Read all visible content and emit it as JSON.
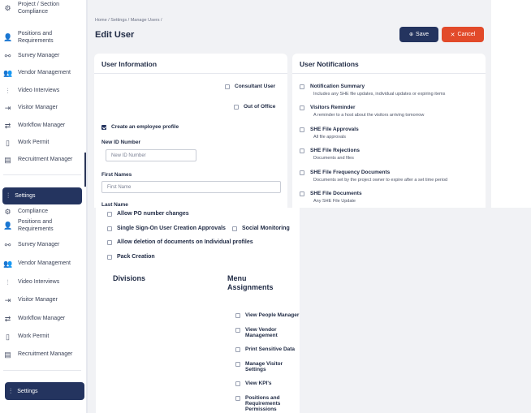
{
  "sidebar_top": {
    "items": [
      {
        "label": "Project / Section Compliance",
        "icon": "gear-icon"
      },
      {
        "label": "Positions and Requirements",
        "icon": "user-plus-icon"
      },
      {
        "label": "Survey Manager",
        "icon": "nodes-icon"
      },
      {
        "label": "Vendor Management",
        "icon": "users-icon"
      },
      {
        "label": "Video Interviews",
        "icon": "sliders-icon"
      },
      {
        "label": "Visitor Manager",
        "icon": "enter-icon"
      },
      {
        "label": "Workflow Manager",
        "icon": "arrows-icon"
      },
      {
        "label": "Work Permit",
        "icon": "document-icon"
      },
      {
        "label": "Recruitment Manager",
        "icon": "id-card-icon"
      }
    ],
    "settings_label": "Settings"
  },
  "sidebar_bottom": {
    "items": [
      {
        "label": "Compliance",
        "icon": "gear-icon"
      },
      {
        "label": "Positions and Requirements",
        "icon": "user-plus-icon"
      },
      {
        "label": "Survey Manager",
        "icon": "nodes-icon"
      },
      {
        "label": "Vendor Management",
        "icon": "users-icon"
      },
      {
        "label": "Video Interviews",
        "icon": "sliders-icon"
      },
      {
        "label": "Visitor Manager",
        "icon": "enter-icon"
      },
      {
        "label": "Workflow Manager",
        "icon": "arrows-icon"
      },
      {
        "label": "Work Permit",
        "icon": "document-icon"
      },
      {
        "label": "Recruitment Manager",
        "icon": "id-card-icon"
      }
    ],
    "settings_label": "Settings"
  },
  "header": {
    "breadcrumb": "Home  /  Settings  /  Manage Users  /",
    "title": "Edit User",
    "save_label": "Save",
    "cancel_label": "Cancel"
  },
  "user_info": {
    "title": "User Information",
    "consultant_user": "Consultant User",
    "out_of_office": "Out of Office",
    "create_employee_profile": "Create an employee profile",
    "new_id_label": "New ID Number",
    "new_id_placeholder": "New ID Number",
    "first_names_label": "First Names",
    "first_name_placeholder": "First Name",
    "last_name_label": "Last Name"
  },
  "notifications": {
    "title": "User Notifications",
    "items": [
      {
        "title": "Notification Summary",
        "desc": "Includes any SHE file updates, individual updates or expiring items"
      },
      {
        "title": "Visitors Reminder",
        "desc": "A reminder to a host about the visitors arriving tomorrow"
      },
      {
        "title": "SHE File Approvals",
        "desc": "All file approvals"
      },
      {
        "title": "SHE File Rejections",
        "desc": "Documents and files"
      },
      {
        "title": "SHE File Frequency Documents",
        "desc": "Documents set by the project owner to expire after a set time period"
      },
      {
        "title": "SHE File Documents",
        "desc": "Any SHE File Update"
      }
    ]
  },
  "permissions": {
    "allow_po": "Allow PO number changes",
    "sso_approvals": "Single Sign-On User Creation Approvals",
    "social_monitoring": "Social Monitoring",
    "allow_deletion": "Allow deletion of documents on Individual profiles",
    "pack_creation": "Pack Creation",
    "divisions_heading": "Divisions",
    "menu_heading": "Menu Assignments",
    "menu_items": [
      "View People Manager",
      "View Vendor Management",
      "Print Sensitive Data",
      "Manage Visitor Settings",
      "View KPI's",
      "Positions and Requirements Permissions"
    ]
  },
  "colors": {
    "primary": "#24345f",
    "danger": "#e24a2a",
    "background": "#f1f2f5"
  }
}
